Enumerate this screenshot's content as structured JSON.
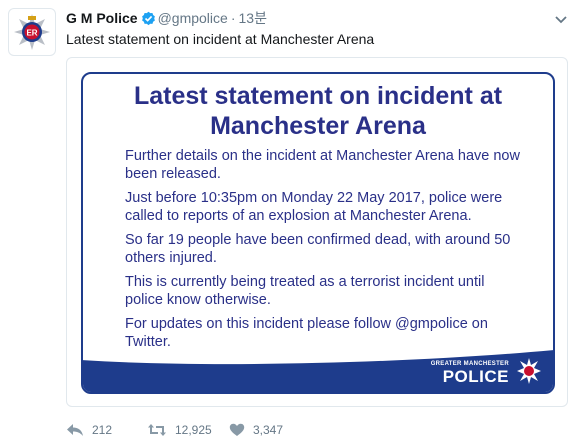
{
  "tweet": {
    "author_name": "G M Police",
    "handle": "@gmpolice",
    "separator": "·",
    "time": "13분",
    "text": "Latest statement on incident at Manchester Arena"
  },
  "statement": {
    "title": "Latest statement on incident at Manchester Arena",
    "paragraphs": [
      "Further details on the incident at Manchester Arena have now been released.",
      "Just before 10:35pm on Monday 22 May 2017, police were called to reports of an explosion at Manchester Arena.",
      "So far 19 people have been confirmed dead, with around 50 others injured.",
      "This is currently being treated as a terrorist incident until police know otherwise.",
      "For updates on this incident please follow @gmpolice on Twitter."
    ],
    "logo_small": "GREATER MANCHESTER",
    "logo_big": "POLICE",
    "badge_letters": "ER"
  },
  "actions": {
    "reply_count": "212",
    "retweet_count": "12,925",
    "like_count": "3,347"
  },
  "colors": {
    "police_blue": "#1e3c8c",
    "text_blue": "#2a3088",
    "verified_blue": "#1da1f2",
    "meta_gray": "#657786"
  },
  "icons": [
    "gmp-badge-icon",
    "verified-icon",
    "chevron-down-icon",
    "reply-icon",
    "retweet-icon",
    "heart-icon"
  ]
}
